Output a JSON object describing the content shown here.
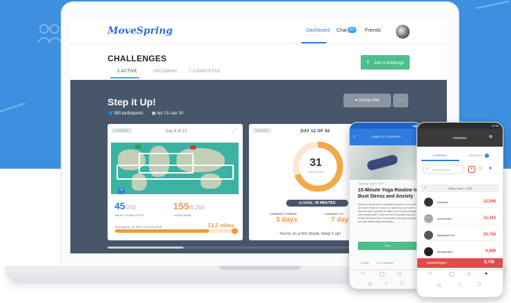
{
  "brand": {
    "logo": "MoveSpring"
  },
  "nav": {
    "dashboard": "Dashboard",
    "chat": "Chat",
    "chat_badge": "20+",
    "friends": "Friends"
  },
  "page": {
    "title": "CHALLENGES",
    "tabs": [
      "2 ACTIVE",
      "UPCOMING",
      "7 COMPLETED"
    ],
    "join_button": "Join a challenge"
  },
  "challenge": {
    "title": "Step it Up!",
    "participants": "360 participants",
    "dates": "Apr 13–Apr 30",
    "group_chat": "Group chat",
    "more": "···"
  },
  "journey_card": {
    "tag": "JOURNEY",
    "day": "Day 8 of 13",
    "miles": "45",
    "miles_total": "/200",
    "miles_label": "MILES COMPLETED",
    "rank": "155",
    "rank_total": "/9,293",
    "rank_label": "YOUR RANK",
    "milestone_label": "DISTANCE TO NEXT MILESTONE:",
    "milestone_value": "13.2 miles",
    "milestone_progress": 0.78
  },
  "streak_card": {
    "tag": "STREAK",
    "day": "DAY 12 OF 50",
    "minutes": "31",
    "minutes_label": "MINUTES",
    "goal": "GOAL: 45 MINUTES",
    "current_label": "CURRENT STREAK",
    "current_value": "3 days",
    "longest_label": "LONGEST ST",
    "longest_value": "7 day",
    "footer": "You're on a hot streak, keep it up!",
    "progress": 0.69
  },
  "phone1": {
    "header": "ACME CO. STEPS UP!",
    "date": "Thursday, July 27, 2017",
    "title": "10-Minute Yoga Routine to Bust Stress and Anxiety",
    "body": "Stress is normal and in moderate amounts, it can even be useful. However, most of us spend far more times than we want, and that can take a toll on your physical and mental health. If you ever feel a stressful day and felt the tension in neck or shoulders, this yoga sequence can help stretch away that stress.",
    "button": "View",
    "likes": "20 likes",
    "comments": "10 comments"
  },
  "phone2": {
    "time": "12:30",
    "header": "FRIENDS",
    "tabs": [
      "10 FRIENDS",
      "REQUESTS"
    ],
    "requests_badge": "0",
    "search_placeholder": "Search friends",
    "date": "Today, May 1, 2018",
    "rows": [
      {
        "name": "sirsophie",
        "value": "12,098"
      },
      {
        "name": "queenbasie",
        "value": "11,343"
      },
      {
        "name": "bigstepper124",
        "value": "10,744"
      },
      {
        "name": "mindyproject",
        "value": "9,999"
      },
      {
        "name": "pepperstepper",
        "value": "8,736"
      }
    ]
  },
  "colors": {
    "accent": "#2f7be0",
    "green": "#4cbf8a",
    "orange": "#f29a3a",
    "red": "#e34b4b",
    "dark": "#475769"
  }
}
